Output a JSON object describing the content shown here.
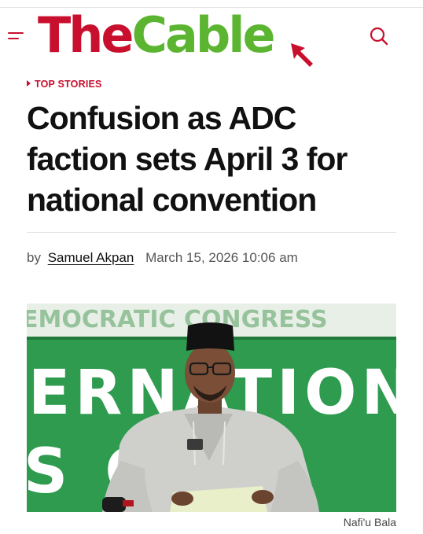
{
  "header": {
    "logo_the": "The",
    "logo_cable": "Cable",
    "logo_alt": "TheCable",
    "menu_icon": "hamburger-menu-icon",
    "search_icon": "search-icon",
    "colors": {
      "brand_red": "#c8102e",
      "brand_green": "#5cb531"
    }
  },
  "article": {
    "category": "TOP STORIES",
    "title": "Confusion as ADC faction sets April 3 for national convention",
    "byline_prefix": "by",
    "author": "Samuel Akpan",
    "date": "March 15, 2026 10:06 am",
    "image": {
      "banner_text_top": "EMOCRATIC CONGRESS",
      "banner_text_mid": "ERNATIONA",
      "banner_text_low": "S C  RE",
      "caption": "Nafi'u Bala"
    }
  }
}
